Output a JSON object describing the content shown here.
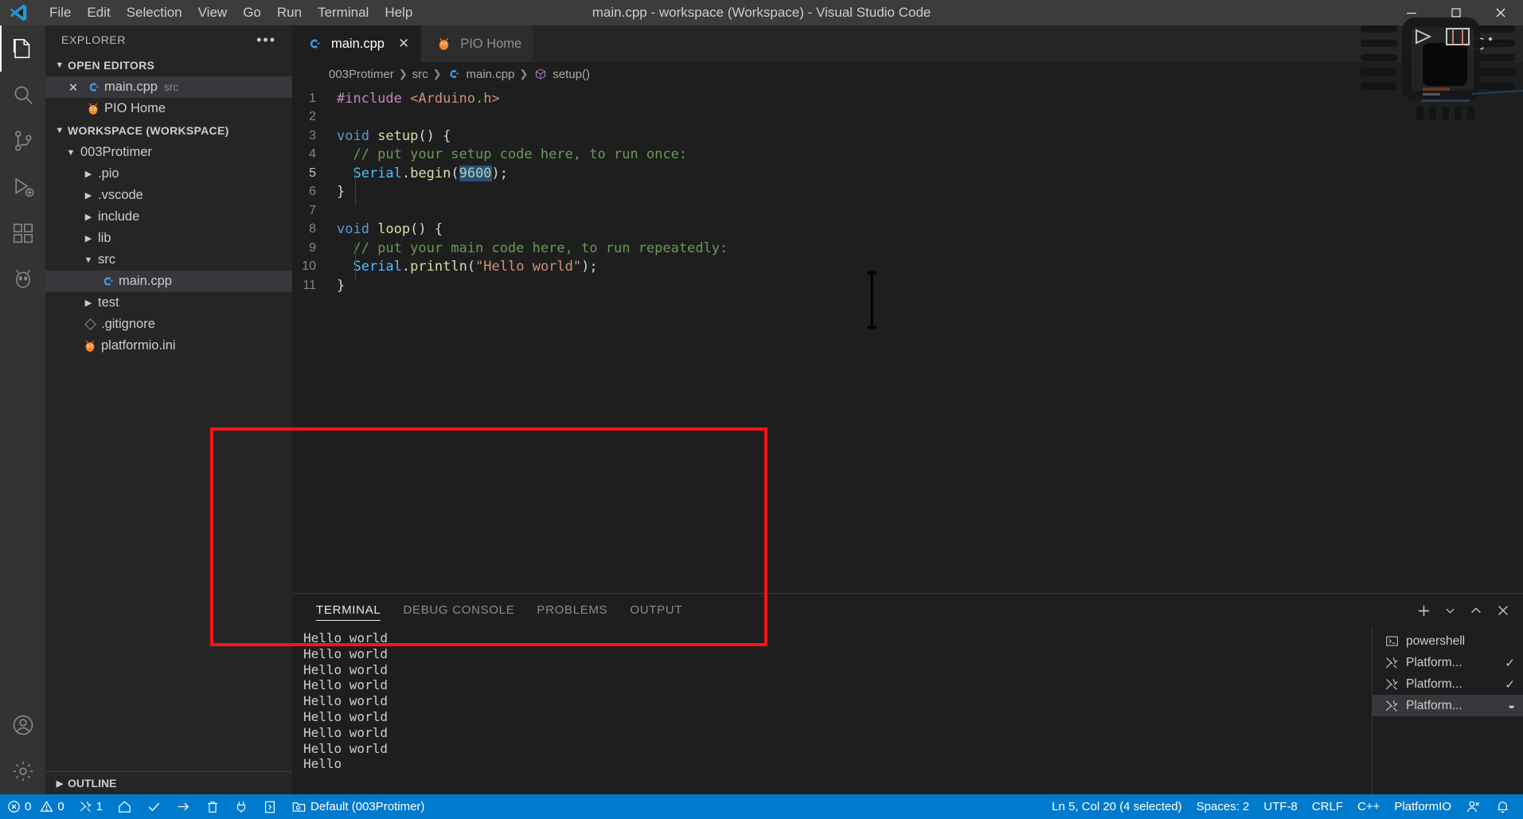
{
  "window": {
    "title": "main.cpp - workspace (Workspace) - Visual Studio Code",
    "minimize_label": "—",
    "maximize_label": "❐",
    "close_label": "✕"
  },
  "menubar": {
    "items": [
      {
        "label": "File"
      },
      {
        "label": "Edit"
      },
      {
        "label": "Selection"
      },
      {
        "label": "View"
      },
      {
        "label": "Go"
      },
      {
        "label": "Run"
      },
      {
        "label": "Terminal"
      },
      {
        "label": "Help"
      }
    ]
  },
  "activitybar": {
    "items": [
      {
        "name": "explorer",
        "icon": "files-icon",
        "active": true
      },
      {
        "name": "search",
        "icon": "search-icon",
        "active": false
      },
      {
        "name": "source-control",
        "icon": "source-control-icon",
        "active": false
      },
      {
        "name": "run-and-debug",
        "icon": "debug-icon",
        "active": false
      },
      {
        "name": "extensions",
        "icon": "extensions-icon",
        "active": false
      },
      {
        "name": "platformio",
        "icon": "platformio-alien-icon",
        "active": false
      }
    ],
    "bottom": [
      {
        "name": "accounts",
        "icon": "account-icon"
      },
      {
        "name": "manage",
        "icon": "gear-icon"
      }
    ]
  },
  "sidebar": {
    "title": "EXPLORER",
    "more_label": "•••",
    "open_editors": {
      "label": "OPEN EDITORS",
      "expanded": true,
      "items": [
        {
          "label": "main.cpp",
          "description": "src",
          "icon": "cpp-file-icon",
          "selected": true,
          "closable": true
        },
        {
          "label": "PIO Home",
          "description": "",
          "icon": "platformio-icon",
          "selected": false,
          "closable": false
        }
      ]
    },
    "workspace": {
      "label": "WORKSPACE (WORKSPACE)",
      "expanded": true,
      "items": [
        {
          "label": "003Protimer",
          "kind": "folder",
          "expanded": true,
          "indent": 1
        },
        {
          "label": ".pio",
          "kind": "folder",
          "expanded": false,
          "indent": 2
        },
        {
          "label": ".vscode",
          "kind": "folder",
          "expanded": false,
          "indent": 2
        },
        {
          "label": "include",
          "kind": "folder",
          "expanded": false,
          "indent": 2
        },
        {
          "label": "lib",
          "kind": "folder",
          "expanded": false,
          "indent": 2
        },
        {
          "label": "src",
          "kind": "folder",
          "expanded": true,
          "indent": 2
        },
        {
          "label": "main.cpp",
          "kind": "cpp-file",
          "indent": 3,
          "selected": true
        },
        {
          "label": "test",
          "kind": "folder",
          "expanded": false,
          "indent": 2
        },
        {
          "label": ".gitignore",
          "kind": "git-file",
          "indent": 2
        },
        {
          "label": "platformio.ini",
          "kind": "platformio-file",
          "indent": 2
        }
      ]
    },
    "outline": {
      "label": "OUTLINE",
      "expanded": false
    }
  },
  "editor": {
    "tabs": [
      {
        "label": "main.cpp",
        "icon": "cpp-file-icon",
        "active": true,
        "closable": true
      },
      {
        "label": "PIO Home",
        "icon": "platformio-icon",
        "active": false,
        "closable": false
      }
    ],
    "breadcrumb": [
      {
        "label": "003Protimer",
        "icon": ""
      },
      {
        "label": "src",
        "icon": ""
      },
      {
        "label": "main.cpp",
        "icon": "cpp-file-icon"
      },
      {
        "label": "setup()",
        "icon": "symbol-method-icon"
      }
    ],
    "lines": [
      {
        "n": "1",
        "segments": [
          {
            "t": "#include ",
            "c": "tok-pre"
          },
          {
            "t": "<Arduino.h>",
            "c": "tok-str-inc"
          }
        ]
      },
      {
        "n": "2",
        "segments": []
      },
      {
        "n": "3",
        "segments": [
          {
            "t": "void ",
            "c": "tok-kw"
          },
          {
            "t": "setup",
            "c": "tok-fn"
          },
          {
            "t": "() {",
            "c": "tok-punc"
          }
        ]
      },
      {
        "n": "4",
        "segments": [
          {
            "t": "  // put your setup code here, to run once:",
            "c": "tok-comment"
          }
        ]
      },
      {
        "n": "5",
        "segments": [
          {
            "t": "  ",
            "c": "tok-punc"
          },
          {
            "t": "Serial",
            "c": "tok-obj"
          },
          {
            "t": ".",
            "c": "tok-punc"
          },
          {
            "t": "begin",
            "c": "tok-fn"
          },
          {
            "t": "(",
            "c": "tok-punc"
          },
          {
            "t": "9600",
            "c": "sel"
          },
          {
            "t": ");",
            "c": "tok-punc"
          }
        ]
      },
      {
        "n": "6",
        "segments": [
          {
            "t": "}",
            "c": "tok-punc"
          }
        ]
      },
      {
        "n": "7",
        "segments": []
      },
      {
        "n": "8",
        "segments": [
          {
            "t": "void ",
            "c": "tok-kw"
          },
          {
            "t": "loop",
            "c": "tok-fn"
          },
          {
            "t": "() {",
            "c": "tok-punc"
          }
        ]
      },
      {
        "n": "9",
        "segments": [
          {
            "t": "  // put your main code here, to run repeatedly:",
            "c": "tok-comment"
          }
        ]
      },
      {
        "n": "10",
        "segments": [
          {
            "t": "  ",
            "c": "tok-punc"
          },
          {
            "t": "Serial",
            "c": "tok-obj"
          },
          {
            "t": ".",
            "c": "tok-punc"
          },
          {
            "t": "println",
            "c": "tok-fn"
          },
          {
            "t": "(",
            "c": "tok-punc"
          },
          {
            "t": "\"Hello world\"",
            "c": "tok-str"
          },
          {
            "t": ");",
            "c": "tok-punc"
          }
        ]
      },
      {
        "n": "11",
        "segments": [
          {
            "t": "}",
            "c": "tok-punc"
          }
        ]
      }
    ]
  },
  "panel": {
    "tabs": [
      {
        "label": "TERMINAL",
        "active": true
      },
      {
        "label": "DEBUG CONSOLE",
        "active": false
      },
      {
        "label": "PROBLEMS",
        "active": false
      },
      {
        "label": "OUTPUT",
        "active": false
      }
    ],
    "actions": [
      {
        "name": "new-terminal-button",
        "icon": "plus-icon"
      },
      {
        "name": "terminal-profile-dropdown",
        "icon": "chevron-down-icon"
      },
      {
        "name": "maximize-panel-button",
        "icon": "chevron-up-icon"
      },
      {
        "name": "close-panel-button",
        "icon": "close-icon"
      }
    ],
    "terminal_output": "Hello world\nHello world\nHello world\nHello world\nHello world\nHello world\nHello world\nHello world\nHello",
    "terminal_list": [
      {
        "label": "powershell",
        "icon": "powershell-icon",
        "state": "",
        "active": false
      },
      {
        "label": "Platform...",
        "icon": "tools-icon",
        "state": "✓",
        "active": false
      },
      {
        "label": "Platform...",
        "icon": "tools-icon",
        "state": "✓",
        "active": false
      },
      {
        "label": "Platform...",
        "icon": "tools-icon",
        "state": "◒",
        "active": true
      }
    ]
  },
  "statusbar": {
    "left": [
      {
        "name": "remote-errors",
        "icon": "error-icon",
        "label": "0"
      },
      {
        "name": "remote-warnings",
        "icon": "warning-icon",
        "label": "0"
      },
      {
        "name": "platformio-tasks",
        "icon": "tools-icon",
        "label": "1"
      },
      {
        "name": "pio-home",
        "icon": "home-icon",
        "label": ""
      },
      {
        "name": "pio-build",
        "icon": "check-icon",
        "label": ""
      },
      {
        "name": "pio-upload",
        "icon": "arrow-right-icon",
        "label": ""
      },
      {
        "name": "pio-clean",
        "icon": "trash-icon",
        "label": ""
      },
      {
        "name": "pio-serial-monitor",
        "icon": "plug-icon",
        "label": ""
      },
      {
        "name": "pio-new-terminal",
        "icon": "terminal-icon",
        "label": ""
      },
      {
        "name": "pio-project-env",
        "icon": "folder-env-icon",
        "label": "Default (003Protimer)"
      }
    ],
    "right": [
      {
        "name": "editor-position",
        "label": "Ln 5, Col 20 (4 selected)"
      },
      {
        "name": "editor-indentation",
        "label": "Spaces: 2"
      },
      {
        "name": "editor-encoding",
        "label": "UTF-8"
      },
      {
        "name": "editor-eol",
        "label": "CRLF"
      },
      {
        "name": "editor-language",
        "label": "C++"
      },
      {
        "name": "platformio-status",
        "label": "PlatformIO"
      },
      {
        "name": "send-feedback",
        "icon": "feedback-icon",
        "label": ""
      },
      {
        "name": "notifications",
        "icon": "bell-icon",
        "label": ""
      }
    ]
  },
  "annotation": {
    "color": "#fb1414",
    "shape": "rectangle"
  },
  "colors": {
    "accent": "#007acc",
    "titlebar_bg": "#3c3c3c",
    "sidebar_bg": "#252526",
    "editor_bg": "#1e1e1e",
    "activitybar_bg": "#333333",
    "selection": "#264f78",
    "annotation_red": "#fb1414"
  }
}
